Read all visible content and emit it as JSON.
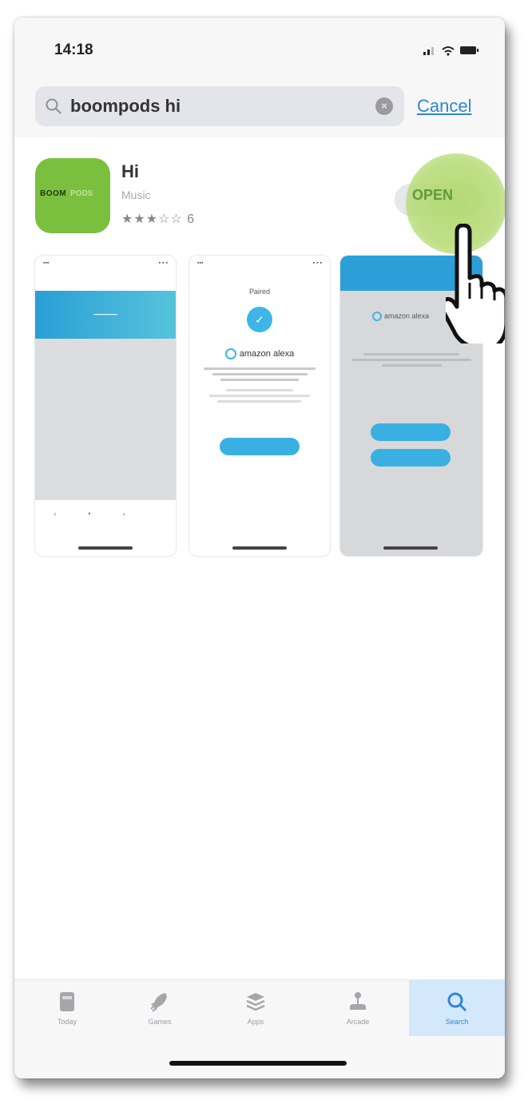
{
  "status_bar": {
    "time": "14:18"
  },
  "search": {
    "query": "boompods hi",
    "cancel_label": "Cancel"
  },
  "result": {
    "app_name": "Hi",
    "category": "Music",
    "rating_stars": "★★★☆☆",
    "rating_count": "6",
    "icon_brand_dark": "BOOM",
    "icon_brand_light": "PODS",
    "open_label": "OPEN"
  },
  "screenshots": {
    "shot2_title": "Paired",
    "shot2_alexa": "amazon alexa",
    "shot3_alexa": "amazon alexa"
  },
  "tabbar": {
    "tabs": [
      {
        "label": "Today",
        "icon": "today-icon"
      },
      {
        "label": "Games",
        "icon": "rocket-icon"
      },
      {
        "label": "Apps",
        "icon": "apps-layers-icon"
      },
      {
        "label": "Arcade",
        "icon": "joystick-icon"
      },
      {
        "label": "Search",
        "icon": "search-icon",
        "active": true
      }
    ]
  },
  "colors": {
    "accent": "#2e86d6",
    "app_icon": "#7bbf3f",
    "open_glow": "#b2d86e"
  }
}
